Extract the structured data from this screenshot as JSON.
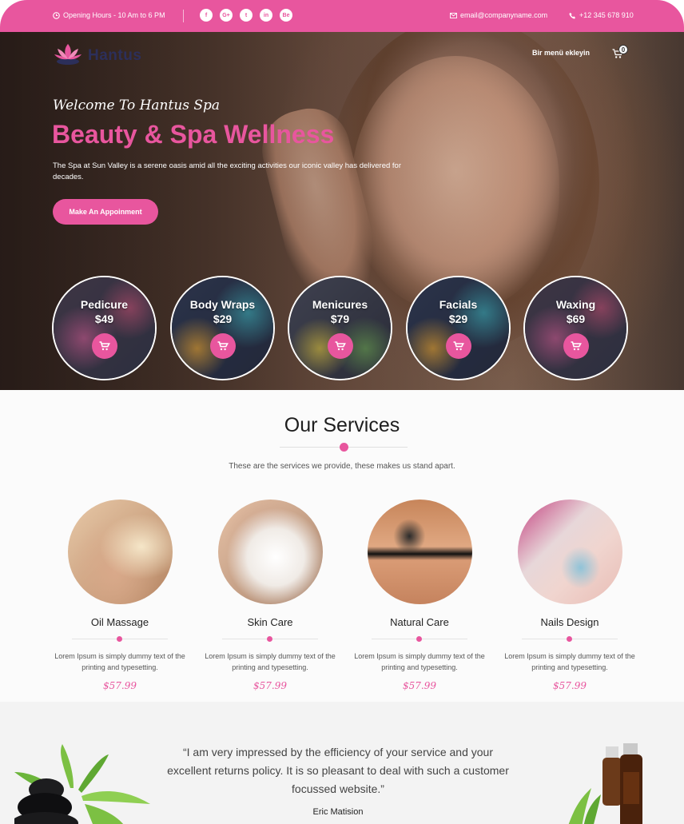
{
  "topbar": {
    "hours": "Opening Hours - 10 Am to 6 PM",
    "social": [
      {
        "icon": "facebook-icon",
        "glyph": "f"
      },
      {
        "icon": "google-plus-icon",
        "glyph": "G+"
      },
      {
        "icon": "twitter-icon",
        "glyph": "t"
      },
      {
        "icon": "linkedin-icon",
        "glyph": "in"
      },
      {
        "icon": "behance-icon",
        "glyph": "Be"
      }
    ],
    "email": "email@companyname.com",
    "phone": "+12 345 678 910"
  },
  "header": {
    "logo_text": "Hantus",
    "nav_item": "Bir menü ekleyin",
    "cart_count": "0"
  },
  "hero": {
    "welcome": "Welcome To Hantus Spa",
    "title": "Beauty & Spa Wellness",
    "description": "The Spa at Sun Valley is a serene oasis amid all the exciting activities our iconic valley has delivered for decades.",
    "button": "Make An Appoinment"
  },
  "products": [
    {
      "name": "Pedicure",
      "price": "$49"
    },
    {
      "name": "Body Wraps",
      "price": "$29"
    },
    {
      "name": "Menicures",
      "price": "$79"
    },
    {
      "name": "Facials",
      "price": "$29"
    },
    {
      "name": "Waxing",
      "price": "$69"
    }
  ],
  "services": {
    "title": "Our Services",
    "subtitle": "These are the services we provide, these makes us stand apart.",
    "items": [
      {
        "title": "Oil Massage",
        "desc": "Lorem Ipsum is simply dummy text of the printing and typesetting.",
        "price": "$57.99"
      },
      {
        "title": "Skin Care",
        "desc": "Lorem Ipsum is simply dummy text of the printing and typesetting.",
        "price": "$57.99"
      },
      {
        "title": "Natural Care",
        "desc": "Lorem Ipsum is simply dummy text of the printing and typesetting.",
        "price": "$57.99"
      },
      {
        "title": "Nails Design",
        "desc": "Lorem Ipsum is simply dummy text of the printing and typesetting.",
        "price": "$57.99"
      }
    ]
  },
  "testimonial": {
    "quote": "“I am very impressed by the efficiency of your service and your excellent returns policy. It is so pleasant to deal with such a customer focussed website.”",
    "author": "Eric Matision"
  },
  "colors": {
    "accent": "#e8569e",
    "logo_text": "#2c2f5a"
  }
}
